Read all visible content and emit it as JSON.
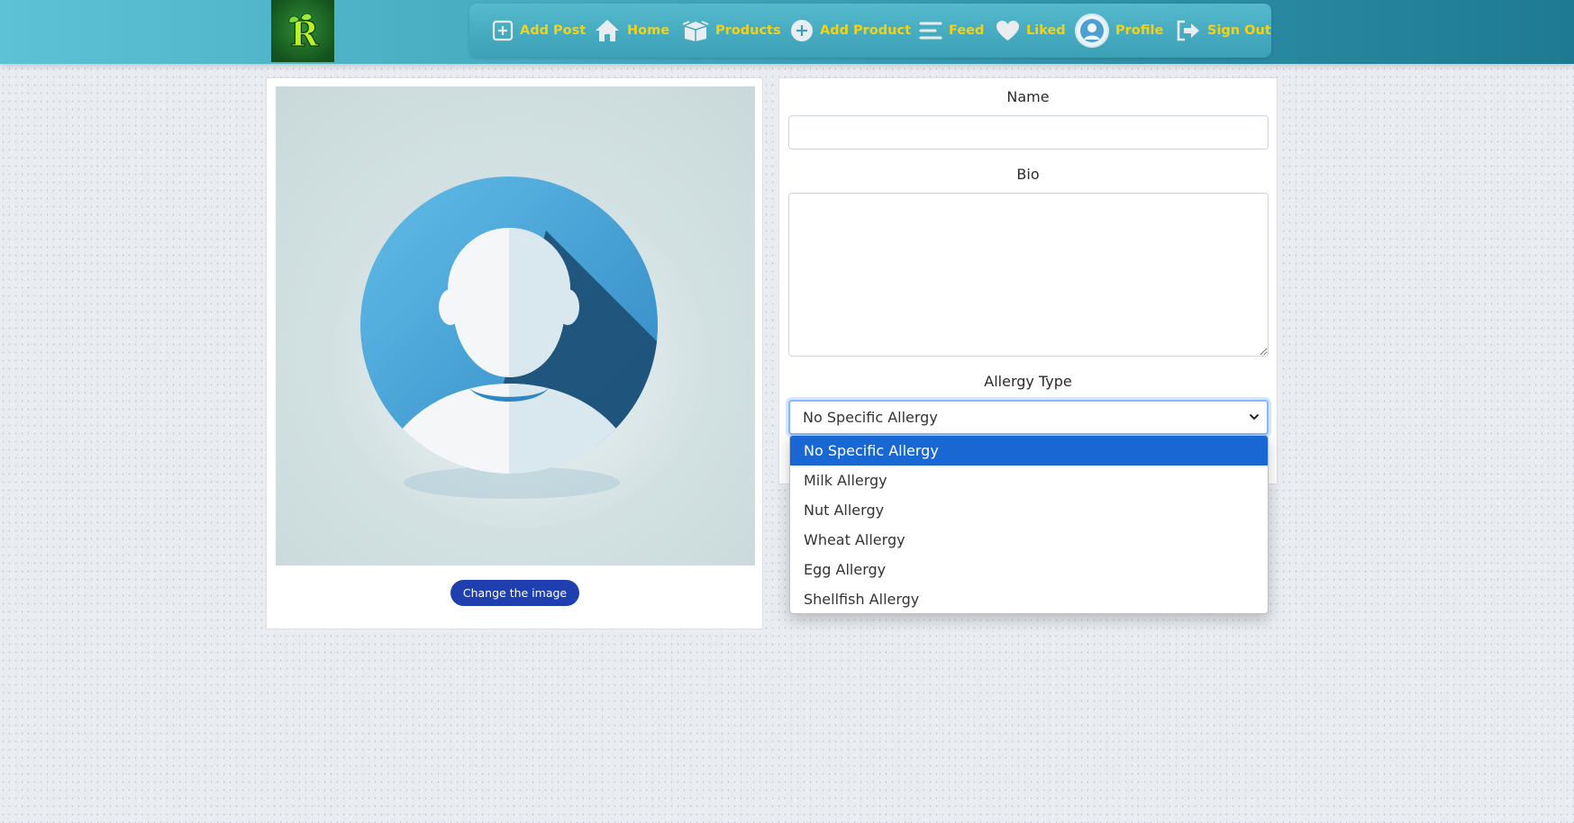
{
  "nav": {
    "items": [
      {
        "label": "Add Post",
        "icon": "plus-square-icon"
      },
      {
        "label": "Home",
        "icon": "home-icon"
      },
      {
        "label": "Products",
        "icon": "box-icon"
      },
      {
        "label": "Add Product",
        "icon": "plus-circle-icon"
      },
      {
        "label": "Feed",
        "icon": "menu-lines-icon"
      },
      {
        "label": "Liked",
        "icon": "heart-icon"
      },
      {
        "label": "Profile",
        "icon": "avatar-icon"
      },
      {
        "label": "Sign Out",
        "icon": "sign-out-icon"
      }
    ],
    "text_color": "#f3d215"
  },
  "logo": {
    "letter": "R",
    "icon": "leaf-r-logo"
  },
  "image_card": {
    "button_label": "Change the image"
  },
  "form": {
    "name_label": "Name",
    "name_value": "",
    "bio_label": "Bio",
    "bio_value": "",
    "allergy_label": "Allergy Type",
    "allergy_selected": "No Specific Allergy",
    "allergy_options": [
      "No Specific Allergy",
      "Milk Allergy",
      "Nut Allergy",
      "Wheat Allergy",
      "Egg Allergy",
      "Shellfish Allergy"
    ]
  },
  "colors": {
    "accent": "#1f3fb0",
    "highlight": "#1967d2",
    "focus_border": "#86b7fe"
  }
}
